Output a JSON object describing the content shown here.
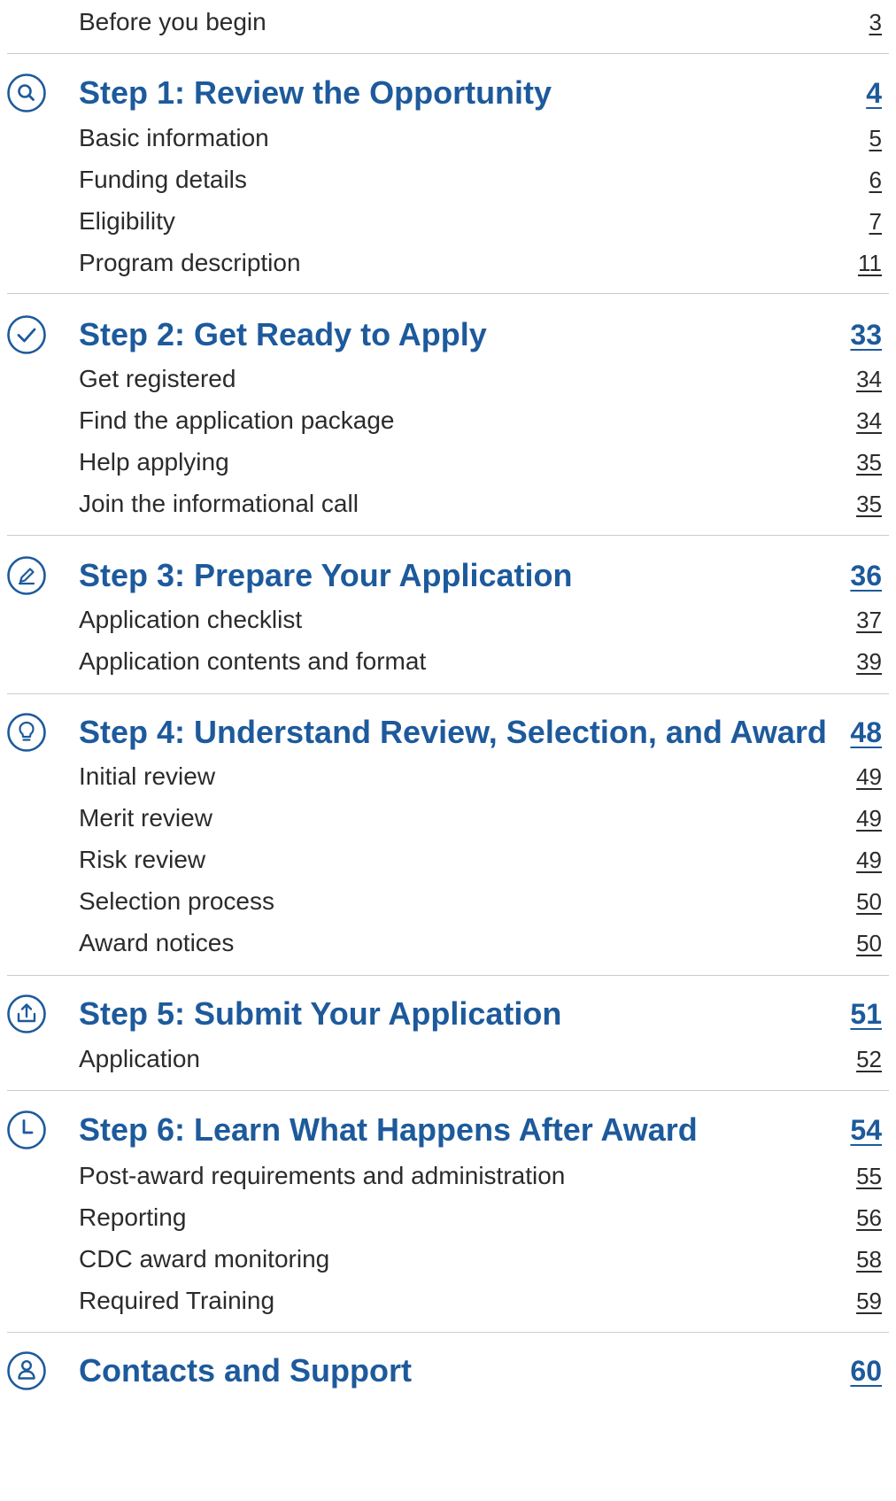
{
  "toc": {
    "intro": {
      "label": "Before you begin",
      "page": "3"
    },
    "steps": [
      {
        "title": "Step 1: Review the Opportunity",
        "page": "4",
        "icon": "search-icon",
        "items": [
          {
            "label": "Basic information",
            "page": "5"
          },
          {
            "label": "Funding details",
            "page": "6"
          },
          {
            "label": "Eligibility",
            "page": "7"
          },
          {
            "label": "Program description",
            "page": "11"
          }
        ]
      },
      {
        "title": "Step 2: Get Ready to Apply",
        "page": "33",
        "icon": "check-circle-icon",
        "items": [
          {
            "label": "Get registered",
            "page": "34"
          },
          {
            "label": "Find the application package",
            "page": "34"
          },
          {
            "label": "Help applying",
            "page": "35"
          },
          {
            "label": "Join the informational call",
            "page": "35"
          }
        ]
      },
      {
        "title": "Step 3: Prepare Your Application",
        "page": "36",
        "icon": "pencil-icon",
        "items": [
          {
            "label": "Application checklist",
            "page": "37"
          },
          {
            "label": "Application contents and format",
            "page": "39"
          }
        ]
      },
      {
        "title": "Step 4: Understand Review, Selection, and Award",
        "page": "48",
        "icon": "lightbulb-icon",
        "items": [
          {
            "label": "Initial review",
            "page": "49"
          },
          {
            "label": "Merit review",
            "page": "49"
          },
          {
            "label": "Risk review",
            "page": "49"
          },
          {
            "label": "Selection process",
            "page": "50"
          },
          {
            "label": "Award notices",
            "page": "50"
          }
        ]
      },
      {
        "title": "Step 5: Submit Your Application",
        "page": "51",
        "icon": "upload-icon",
        "items": [
          {
            "label": "Application",
            "page": "52"
          }
        ]
      },
      {
        "title": "Step 6: Learn What Happens After Award",
        "page": "54",
        "icon": "clock-icon",
        "items": [
          {
            "label": "Post-award requirements and administration",
            "page": "55"
          },
          {
            "label": "Reporting",
            "page": "56"
          },
          {
            "label": "CDC award monitoring",
            "page": "58"
          },
          {
            "label": "Required Training",
            "page": "59"
          }
        ]
      },
      {
        "title": "Contacts and Support",
        "page": "60",
        "icon": "person-icon",
        "items": []
      }
    ]
  },
  "colors": {
    "heading": "#1d5a9c",
    "text": "#2b2b2b",
    "divider": "#c9ccd1"
  }
}
